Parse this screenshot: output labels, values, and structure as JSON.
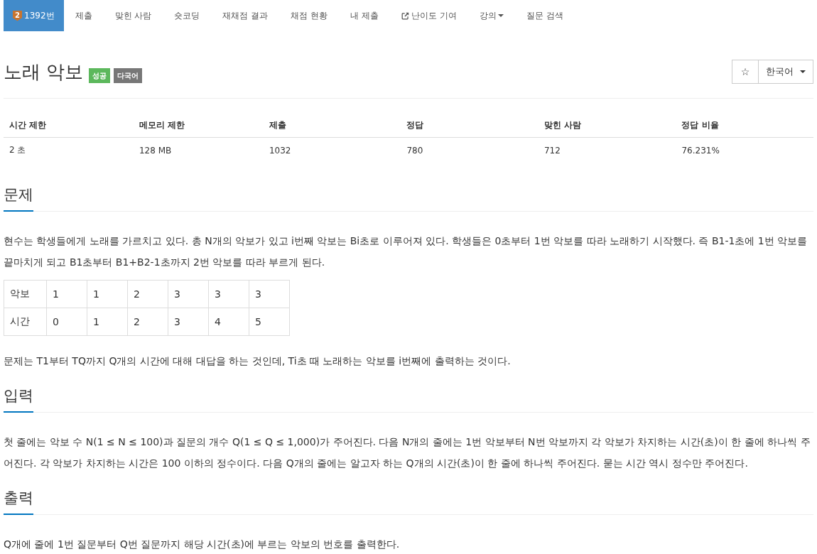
{
  "nav": {
    "items": [
      {
        "kind": "problem",
        "label": "1392번",
        "tier": "2",
        "selected": true
      },
      {
        "kind": "link",
        "label": "제출",
        "selected": false
      },
      {
        "kind": "link",
        "label": "맞힌 사람",
        "selected": false
      },
      {
        "kind": "link",
        "label": "숏코딩",
        "selected": false
      },
      {
        "kind": "link",
        "label": "재채점 결과",
        "selected": false
      },
      {
        "kind": "link",
        "label": "채점 현황",
        "selected": false
      },
      {
        "kind": "link",
        "label": "내 제출",
        "selected": false
      },
      {
        "kind": "external",
        "label": "난이도 기여",
        "selected": false
      },
      {
        "kind": "dropdown",
        "label": "강의",
        "selected": false
      },
      {
        "kind": "link",
        "label": "질문 검색",
        "selected": false
      }
    ]
  },
  "header": {
    "title": "노래 악보",
    "labels": [
      {
        "text": "성공",
        "color": "#5cb85c"
      },
      {
        "text": "다국어",
        "color": "#777777"
      }
    ],
    "star": "☆",
    "language": "한국어"
  },
  "stats": {
    "columns": [
      "시간 제한",
      "메모리 제한",
      "제출",
      "정답",
      "맞힌 사람",
      "정답 비율"
    ],
    "rows": [
      [
        "2 초",
        "128 MB",
        "1032",
        "780",
        "712",
        "76.231%"
      ]
    ]
  },
  "sections": [
    {
      "heading": "문제",
      "blocks": [
        {
          "kind": "paragraph",
          "text": "현수는 학생들에게 노래를 가르치고 있다. 총 N개의 악보가 있고 i번째 악보는 Bi초로 이루어져 있다. 학생들은 0초부터 1번 악보를 따라 노래하기 시작했다. 즉 B1-1초에 1번 악보를 끝마치게 되고 B1초부터 B1+B2-1초까지 2번 악보를 따라 부르게 된다."
        },
        {
          "kind": "table",
          "rows": [
            [
              "악보",
              "1",
              "1",
              "2",
              "3",
              "3",
              "3"
            ],
            [
              "시간",
              "0",
              "1",
              "2",
              "3",
              "4",
              "5"
            ]
          ]
        },
        {
          "kind": "paragraph",
          "text": "문제는 T1부터 TQ까지 Q개의 시간에 대해 대답을 하는 것인데, Ti초 때 노래하는 악보를 i번째에 출력하는 것이다."
        }
      ]
    },
    {
      "heading": "입력",
      "blocks": [
        {
          "kind": "paragraph",
          "text": "첫 줄에는 악보 수 N(1 ≤ N ≤ 100)과 질문의 개수 Q(1 ≤ Q ≤ 1,000)가 주어진다. 다음 N개의 줄에는 1번 악보부터 N번 악보까지 각 악보가 차지하는 시간(초)이 한 줄에 하나씩 주어진다. 각 악보가 차지하는 시간은 100 이하의 정수이다. 다음 Q개의 줄에는 알고자 하는 Q개의 시간(초)이 한 줄에 하나씩 주어진다. 묻는 시간 역시 정수만 주어진다."
        }
      ]
    },
    {
      "heading": "출력",
      "blocks": [
        {
          "kind": "paragraph",
          "text": "Q개에 줄에 1번 질문부터 Q번 질문까지 해당 시간(초)에 부르는 악보의 번호를 출력한다."
        }
      ]
    }
  ]
}
